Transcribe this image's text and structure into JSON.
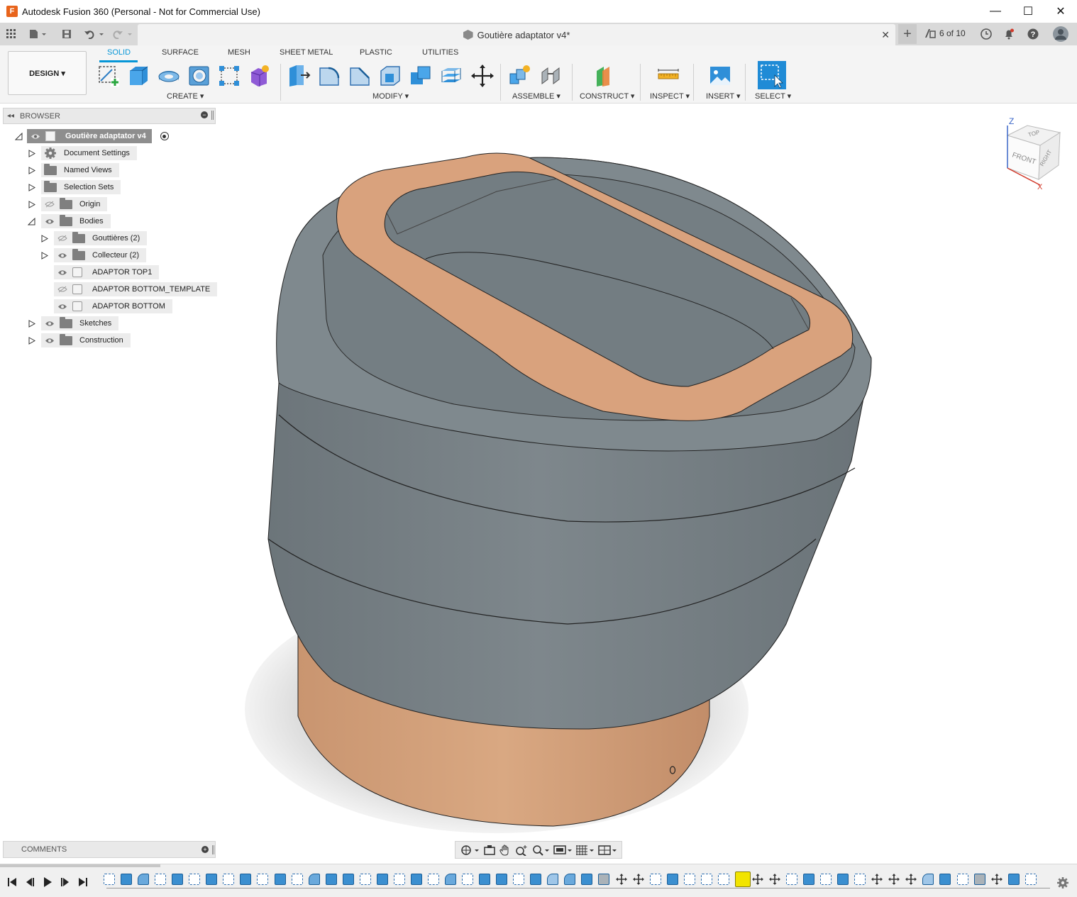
{
  "window": {
    "title": "Autodesk Fusion 360 (Personal - Not for Commercial Use)",
    "app_icon_letter": "F",
    "controls": [
      "—",
      "☐",
      "✕"
    ]
  },
  "tabbar": {
    "document_tab": "Goutière adaptator v4*",
    "close_glyph": "✕",
    "add_glyph": "+",
    "version_counter": "6 of 10"
  },
  "ribbon": {
    "workspace_button": "DESIGN ▾",
    "tabs": [
      "SOLID",
      "SURFACE",
      "MESH",
      "SHEET METAL",
      "PLASTIC",
      "UTILITIES"
    ],
    "active_tab": "SOLID",
    "groups": [
      "CREATE ▾",
      "MODIFY ▾",
      "ASSEMBLE ▾",
      "CONSTRUCT ▾",
      "INSPECT ▾",
      "INSERT ▾",
      "SELECT ▾"
    ],
    "accent_color": "#0696d7"
  },
  "browser": {
    "title": "BROWSER",
    "root": "Goutière adaptator v4",
    "items": [
      {
        "label": "Document Settings",
        "icon": "gear-icon"
      },
      {
        "label": "Named Views",
        "icon": "folder-icon"
      },
      {
        "label": "Selection Sets",
        "icon": "folder-icon"
      },
      {
        "label": "Origin",
        "icon": "folder-icon",
        "visible": false
      },
      {
        "label": "Bodies",
        "icon": "folder-icon",
        "expanded": true
      },
      {
        "label": "Gouttières (2)",
        "icon": "folder-icon",
        "visible": false
      },
      {
        "label": "Collecteur (2)",
        "icon": "folder-icon"
      },
      {
        "label": "ADAPTOR TOP1",
        "icon": "body-icon"
      },
      {
        "label": "ADAPTOR BOTTOM_TEMPLATE",
        "icon": "body-icon",
        "visible": false
      },
      {
        "label": "ADAPTOR BOTTOM",
        "icon": "body-icon"
      },
      {
        "label": "Sketches",
        "icon": "folder-icon"
      },
      {
        "label": "Construction",
        "icon": "folder-icon"
      }
    ]
  },
  "comments": {
    "title": "COMMENTS"
  },
  "viewcube": {
    "faces": [
      "TOP",
      "FRONT",
      "RIGHT"
    ],
    "axes": [
      "Z",
      "X"
    ]
  },
  "model_colors": {
    "body_gray": "#7f898e",
    "copper": "#d9a27d"
  }
}
